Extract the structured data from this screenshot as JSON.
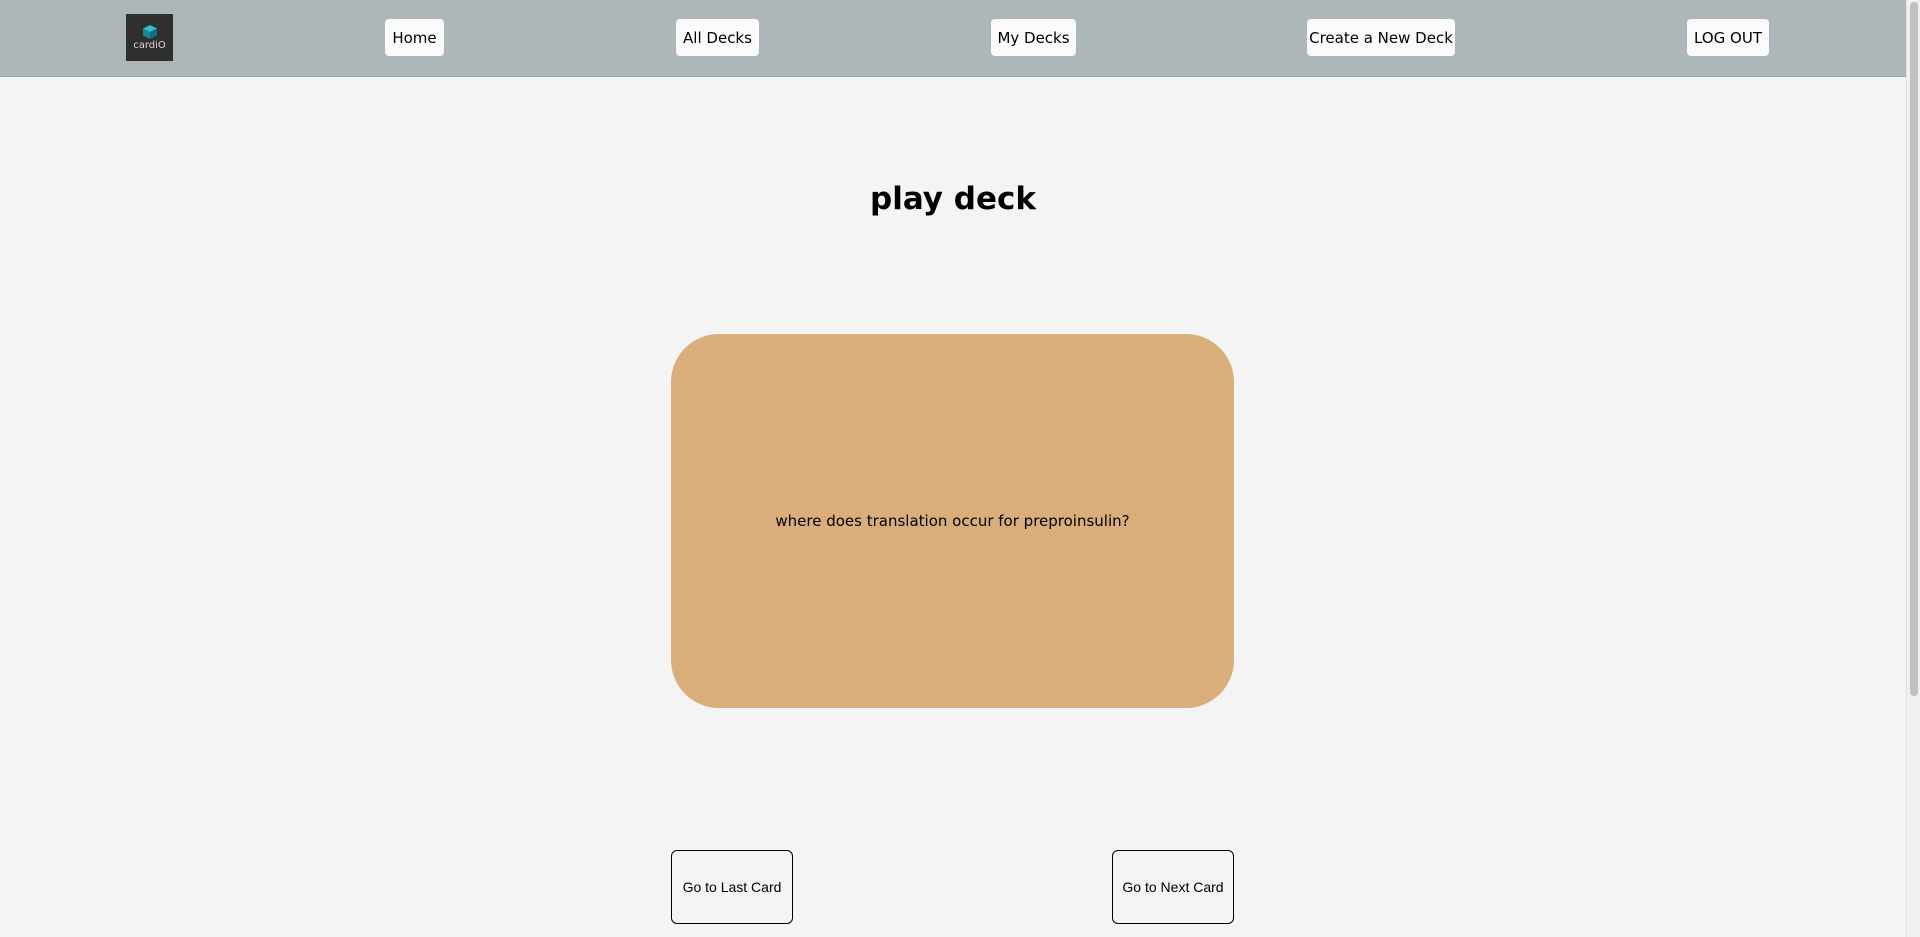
{
  "navbar": {
    "logo_text": "cardiO",
    "items": [
      {
        "label": "Home"
      },
      {
        "label": "All Decks"
      },
      {
        "label": "My Decks"
      },
      {
        "label": "Create a New Deck"
      },
      {
        "label": "LOG OUT"
      }
    ]
  },
  "main": {
    "title": "play deck",
    "card": {
      "question": "where does translation occur for preproinsulin?"
    },
    "buttons": {
      "prev_label": "Go to Last Card",
      "next_label": "Go to Next Card"
    }
  },
  "colors": {
    "navbar_bg": "#adb6b9",
    "page_bg": "#f4f4f4",
    "card_bg": "#d9ae7b",
    "logo_bg": "#2f2f2f",
    "logo_accent": "#1aa3b3"
  },
  "icons": {
    "logo": "cube-icon"
  }
}
